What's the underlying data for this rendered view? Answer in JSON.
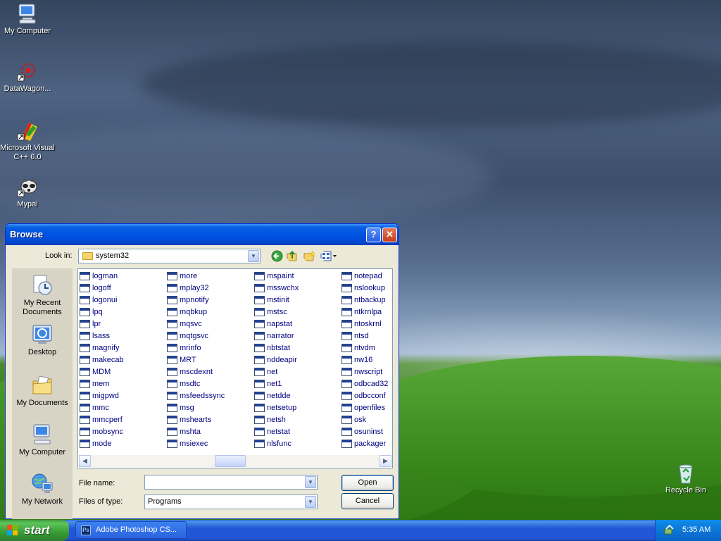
{
  "desktop": {
    "icons": [
      {
        "label": "My Computer"
      },
      {
        "label": "DataWagon..."
      },
      {
        "label": "Microsoft Visual C++ 6.0"
      },
      {
        "label": "Mypal"
      },
      {
        "label": "Recycle Bin"
      }
    ]
  },
  "dialog": {
    "title": "Browse",
    "help_glyph": "?",
    "close_glyph": "✕",
    "look_in_label": "Look in:",
    "look_in_value": "system32",
    "places": [
      {
        "label": "My Recent Documents"
      },
      {
        "label": "Desktop"
      },
      {
        "label": "My Documents"
      },
      {
        "label": "My Computer"
      },
      {
        "label": "My Network"
      }
    ],
    "files": {
      "col1": [
        "logman",
        "logoff",
        "logonui",
        "lpq",
        "lpr",
        "lsass",
        "magnify",
        "makecab",
        "MDM",
        "mem",
        "migpwd",
        "mmc",
        "mmcperf",
        "mobsync",
        "mode"
      ],
      "col2": [
        "more",
        "mplay32",
        "mpnotify",
        "mqbkup",
        "mqsvc",
        "mqtgsvc",
        "mrinfo",
        "MRT",
        "mscdexnt",
        "msdtc",
        "msfeedssync",
        "msg",
        "mshearts",
        "mshta",
        "msiexec"
      ],
      "col3": [
        "mspaint",
        "msswchx",
        "mstinit",
        "mstsc",
        "napstat",
        "narrator",
        "nbtstat",
        "nddeapir",
        "net",
        "net1",
        "netdde",
        "netsetup",
        "netsh",
        "netstat",
        "nlsfunc"
      ],
      "col4": [
        "notepad",
        "nslookup",
        "ntbackup",
        "ntkrnlpa",
        "ntoskrnl",
        "ntsd",
        "ntvdm",
        "nw16",
        "nwscript",
        "odbcad32",
        "odbcconf",
        "openfiles",
        "osk",
        "osuninst",
        "packager"
      ]
    },
    "file_name_label": "File name:",
    "file_name_value": "",
    "file_type_label": "Files of type:",
    "file_type_value": "Programs",
    "open_label": "Open",
    "cancel_label": "Cancel"
  },
  "taskbar": {
    "start_label": "start",
    "task_label": "Adobe Photoshop CS...",
    "task_icon_text": "Ps",
    "clock": "5:35 AM"
  },
  "colors": {
    "titlebar": "#0054e3",
    "start": "#379c35",
    "taskbar": "#2157d7",
    "link": "#000080"
  }
}
